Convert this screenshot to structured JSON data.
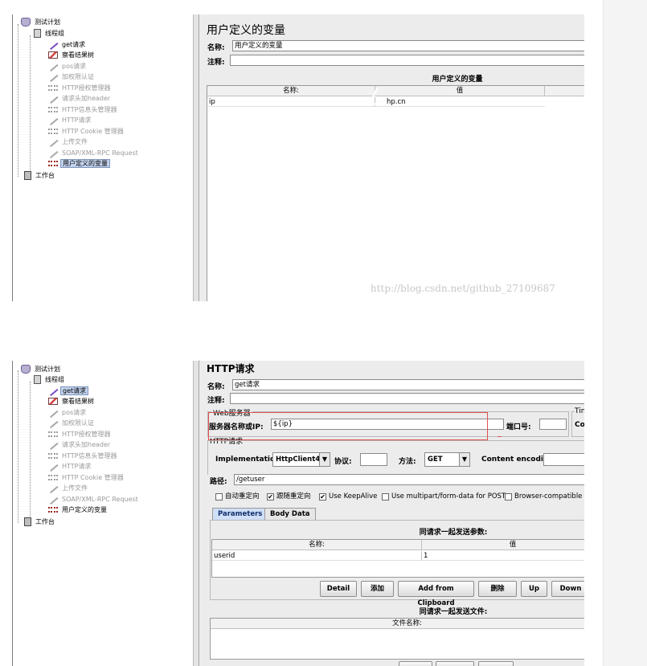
{
  "tree": {
    "items": [
      {
        "label": "测试计划",
        "icon": "flask-icon"
      },
      {
        "label": "线程组",
        "icon": "spool-icon"
      },
      {
        "label": "get请求",
        "icon": "pen-icon"
      },
      {
        "label": "察看结果树",
        "icon": "chart-icon"
      },
      {
        "label": "pos请求",
        "icon": "pen-icon"
      },
      {
        "label": "加权限认证",
        "icon": "pen-icon"
      },
      {
        "label": "HTTP授权管理器",
        "icon": "gear-icon"
      },
      {
        "label": "请求头加header",
        "icon": "pen-icon"
      },
      {
        "label": "HTTP信息头管理器",
        "icon": "gear-icon"
      },
      {
        "label": "HTTP请求",
        "icon": "pen-icon"
      },
      {
        "label": "HTTP Cookie 管理器",
        "icon": "gear-icon"
      },
      {
        "label": "上传文件",
        "icon": "pen-icon"
      },
      {
        "label": "SOAP/XML-RPC Request",
        "icon": "pen-icon"
      },
      {
        "label": "用户定义的变量",
        "icon": "gear-icon"
      },
      {
        "label": "工作台",
        "icon": "book-icon"
      }
    ]
  },
  "panel1": {
    "title": "用户定义的变量",
    "name_label": "名称:",
    "name_value": "用户定义的变量",
    "comment_label": "注释:",
    "table_title": "用户定义的变量",
    "col_name": "名称:",
    "col_value": "值",
    "row_name": "ip",
    "row_value": "hp.cn",
    "watermark": "http://blog.csdn.net/github_27109687"
  },
  "panel2": {
    "title": "HTTP请求",
    "name_label": "名称:",
    "name_value": "get请求",
    "comment_label": "注释:",
    "web_server_label": "Web服务器",
    "timeout_label": "Tin",
    "server_label": "服务器名称或IP:",
    "server_value": "${ip}",
    "port_label": "端口号:",
    "port_value": "",
    "timeout_sub": "Cor",
    "http_request_label": "HTTP请求",
    "impl_label": "Implementation:",
    "impl_value": "HttpClient4",
    "protocol_label": "协议:",
    "method_label": "方法:",
    "method_value": "GET",
    "encoding_label": "Content encoding:",
    "path_label": "路径:",
    "path_value": "/getuser",
    "checkboxes": [
      {
        "label": "自动重定向",
        "checked": false
      },
      {
        "label": "跟随重定向",
        "checked": true
      },
      {
        "label": "Use KeepAlive",
        "checked": true
      },
      {
        "label": "Use multipart/form-data for POST",
        "checked": false
      },
      {
        "label": "Browser-compatible h",
        "checked": false
      }
    ],
    "tabs": [
      "Parameters",
      "Body Data"
    ],
    "params_title": "同请求一起发送参数:",
    "col_name": "名称:",
    "col_value": "值",
    "param_name": "userid",
    "param_value": "1",
    "buttons": [
      "Detail",
      "添加",
      "Add from Clipboard",
      "删除",
      "Up",
      "Down"
    ],
    "files_title": "同请求一起发送文件:",
    "file_col": "文件名称:"
  },
  "colors": {
    "highlight_box": "#e05050",
    "selected": "#c3d3ee",
    "tab_active": "#cfe0f7"
  }
}
